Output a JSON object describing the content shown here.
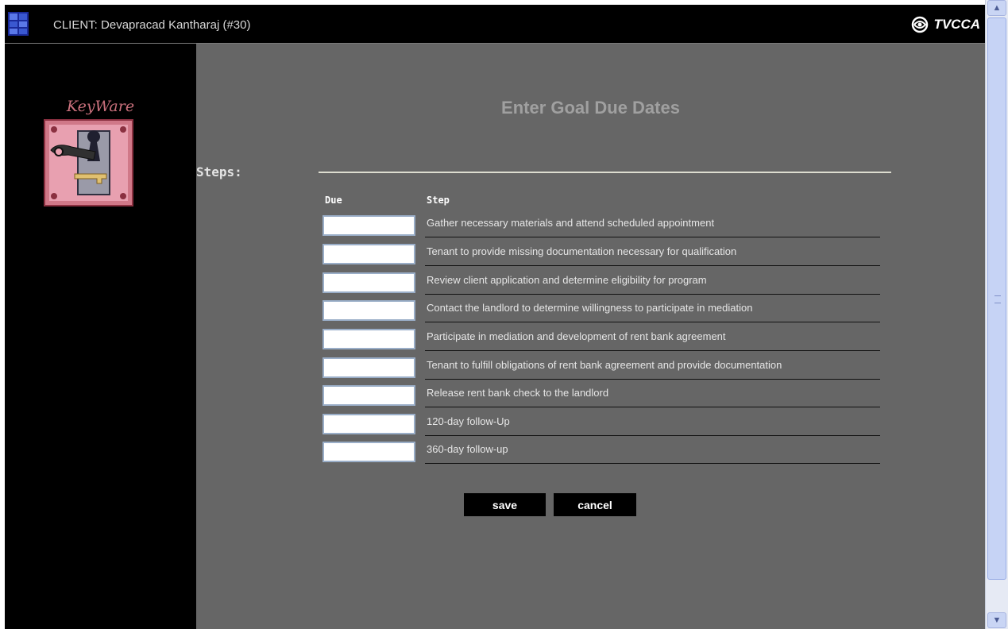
{
  "header": {
    "client_title": "CLIENT: Devapraсad Kantharaj (#30)",
    "brand": "TVCCA"
  },
  "sidebar": {
    "logo_text": "KeyWare"
  },
  "main": {
    "title": "Enter Goal Due Dates",
    "steps_label": "Steps:",
    "columns": {
      "due": "Due",
      "step": "Step"
    },
    "steps": [
      {
        "due": "",
        "step": "Gather necessary materials and attend scheduled appointment"
      },
      {
        "due": "",
        "step": "Tenant to provide missing documentation necessary for qualification"
      },
      {
        "due": "",
        "step": "Review client application and determine eligibility for program"
      },
      {
        "due": "",
        "step": "Contact the landlord to determine willingness to participate in mediation"
      },
      {
        "due": "",
        "step": "Participate in mediation and development of rent bank agreement"
      },
      {
        "due": "",
        "step": "Tenant to fulfill obligations of rent bank agreement and provide documentation"
      },
      {
        "due": "",
        "step": "Release rent bank check to the landlord"
      },
      {
        "due": "",
        "step": "120-day follow-Up"
      },
      {
        "due": "",
        "step": "360-day follow-up"
      }
    ],
    "save_label": "save",
    "cancel_label": "cancel"
  },
  "colors": {
    "main_bg": "#666666",
    "sidebar_bg": "#000000",
    "title_color": "#a0a0a0",
    "logo_pink": "#c9707c"
  },
  "icons": {
    "app": "app-grid-icon",
    "brand": "tvcca-swirl-icon",
    "keyware": "keyhole-key-icon"
  }
}
